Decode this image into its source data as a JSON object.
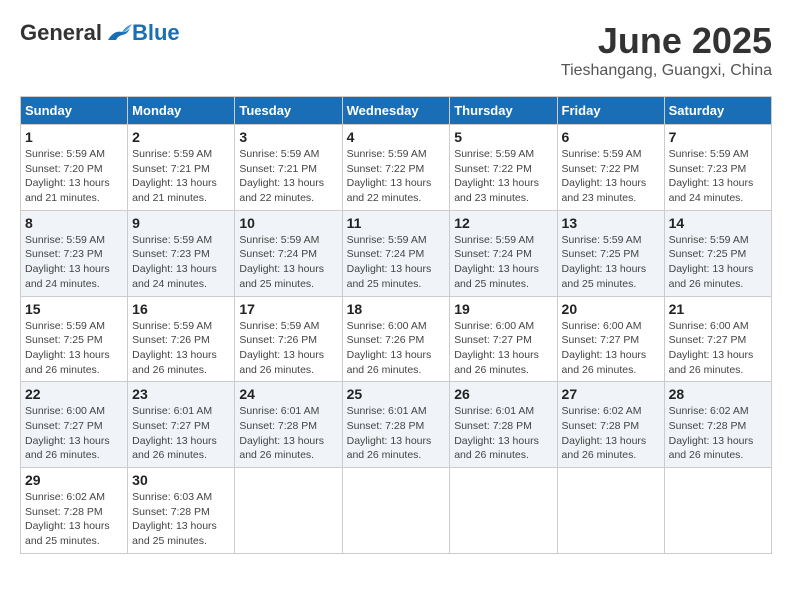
{
  "header": {
    "logo_general": "General",
    "logo_blue": "Blue",
    "month_title": "June 2025",
    "location": "Tieshangang, Guangxi, China"
  },
  "columns": [
    "Sunday",
    "Monday",
    "Tuesday",
    "Wednesday",
    "Thursday",
    "Friday",
    "Saturday"
  ],
  "rows": [
    [
      {
        "day": "1",
        "sunrise": "5:59 AM",
        "sunset": "7:20 PM",
        "daylight": "13 hours and 21 minutes."
      },
      {
        "day": "2",
        "sunrise": "5:59 AM",
        "sunset": "7:21 PM",
        "daylight": "13 hours and 21 minutes."
      },
      {
        "day": "3",
        "sunrise": "5:59 AM",
        "sunset": "7:21 PM",
        "daylight": "13 hours and 22 minutes."
      },
      {
        "day": "4",
        "sunrise": "5:59 AM",
        "sunset": "7:22 PM",
        "daylight": "13 hours and 22 minutes."
      },
      {
        "day": "5",
        "sunrise": "5:59 AM",
        "sunset": "7:22 PM",
        "daylight": "13 hours and 23 minutes."
      },
      {
        "day": "6",
        "sunrise": "5:59 AM",
        "sunset": "7:22 PM",
        "daylight": "13 hours and 23 minutes."
      },
      {
        "day": "7",
        "sunrise": "5:59 AM",
        "sunset": "7:23 PM",
        "daylight": "13 hours and 24 minutes."
      }
    ],
    [
      {
        "day": "8",
        "sunrise": "5:59 AM",
        "sunset": "7:23 PM",
        "daylight": "13 hours and 24 minutes."
      },
      {
        "day": "9",
        "sunrise": "5:59 AM",
        "sunset": "7:23 PM",
        "daylight": "13 hours and 24 minutes."
      },
      {
        "day": "10",
        "sunrise": "5:59 AM",
        "sunset": "7:24 PM",
        "daylight": "13 hours and 25 minutes."
      },
      {
        "day": "11",
        "sunrise": "5:59 AM",
        "sunset": "7:24 PM",
        "daylight": "13 hours and 25 minutes."
      },
      {
        "day": "12",
        "sunrise": "5:59 AM",
        "sunset": "7:24 PM",
        "daylight": "13 hours and 25 minutes."
      },
      {
        "day": "13",
        "sunrise": "5:59 AM",
        "sunset": "7:25 PM",
        "daylight": "13 hours and 25 minutes."
      },
      {
        "day": "14",
        "sunrise": "5:59 AM",
        "sunset": "7:25 PM",
        "daylight": "13 hours and 26 minutes."
      }
    ],
    [
      {
        "day": "15",
        "sunrise": "5:59 AM",
        "sunset": "7:25 PM",
        "daylight": "13 hours and 26 minutes."
      },
      {
        "day": "16",
        "sunrise": "5:59 AM",
        "sunset": "7:26 PM",
        "daylight": "13 hours and 26 minutes."
      },
      {
        "day": "17",
        "sunrise": "5:59 AM",
        "sunset": "7:26 PM",
        "daylight": "13 hours and 26 minutes."
      },
      {
        "day": "18",
        "sunrise": "6:00 AM",
        "sunset": "7:26 PM",
        "daylight": "13 hours and 26 minutes."
      },
      {
        "day": "19",
        "sunrise": "6:00 AM",
        "sunset": "7:27 PM",
        "daylight": "13 hours and 26 minutes."
      },
      {
        "day": "20",
        "sunrise": "6:00 AM",
        "sunset": "7:27 PM",
        "daylight": "13 hours and 26 minutes."
      },
      {
        "day": "21",
        "sunrise": "6:00 AM",
        "sunset": "7:27 PM",
        "daylight": "13 hours and 26 minutes."
      }
    ],
    [
      {
        "day": "22",
        "sunrise": "6:00 AM",
        "sunset": "7:27 PM",
        "daylight": "13 hours and 26 minutes."
      },
      {
        "day": "23",
        "sunrise": "6:01 AM",
        "sunset": "7:27 PM",
        "daylight": "13 hours and 26 minutes."
      },
      {
        "day": "24",
        "sunrise": "6:01 AM",
        "sunset": "7:28 PM",
        "daylight": "13 hours and 26 minutes."
      },
      {
        "day": "25",
        "sunrise": "6:01 AM",
        "sunset": "7:28 PM",
        "daylight": "13 hours and 26 minutes."
      },
      {
        "day": "26",
        "sunrise": "6:01 AM",
        "sunset": "7:28 PM",
        "daylight": "13 hours and 26 minutes."
      },
      {
        "day": "27",
        "sunrise": "6:02 AM",
        "sunset": "7:28 PM",
        "daylight": "13 hours and 26 minutes."
      },
      {
        "day": "28",
        "sunrise": "6:02 AM",
        "sunset": "7:28 PM",
        "daylight": "13 hours and 26 minutes."
      }
    ],
    [
      {
        "day": "29",
        "sunrise": "6:02 AM",
        "sunset": "7:28 PM",
        "daylight": "13 hours and 25 minutes."
      },
      {
        "day": "30",
        "sunrise": "6:03 AM",
        "sunset": "7:28 PM",
        "daylight": "13 hours and 25 minutes."
      },
      null,
      null,
      null,
      null,
      null
    ]
  ],
  "labels": {
    "sunrise": "Sunrise:",
    "sunset": "Sunset:",
    "daylight": "Daylight:"
  }
}
